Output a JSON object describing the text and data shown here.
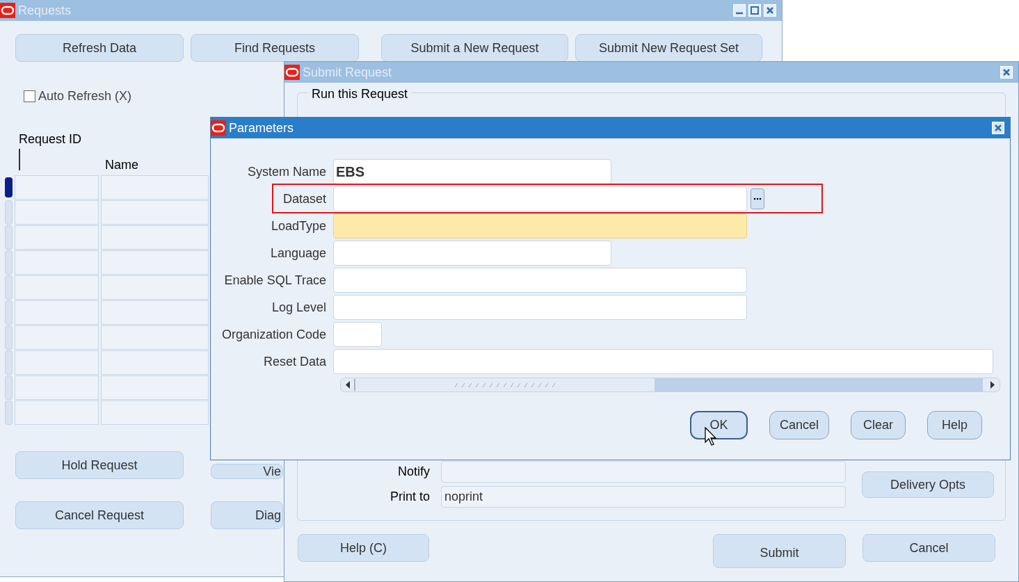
{
  "requests_window": {
    "title": "Requests",
    "active": false,
    "buttons": [
      "Refresh Data",
      "Find Requests",
      "Submit a New Request",
      "Submit New Request Set"
    ],
    "auto_refresh": {
      "label": "Auto Refresh (X)",
      "checked": false
    },
    "columns": [
      "Request ID",
      "Name"
    ],
    "rows": [
      {
        "selected": true
      },
      {
        "selected": false
      },
      {
        "selected": false
      },
      {
        "selected": false
      },
      {
        "selected": false
      },
      {
        "selected": false
      },
      {
        "selected": false
      },
      {
        "selected": false
      },
      {
        "selected": false
      },
      {
        "selected": false
      }
    ],
    "bottom_buttons": [
      "Hold Request",
      "Vie",
      "Cancel Request",
      "Diag"
    ]
  },
  "submit_window": {
    "title": "Submit Request",
    "active": false,
    "group_title": "Run this Request",
    "fields": [
      {
        "label": "Notify"
      },
      {
        "label": "Print to",
        "value": "noprint"
      }
    ],
    "delivery_button": "Delivery Opts",
    "buttons": [
      "Help (C)",
      "Submit",
      "Cancel"
    ]
  },
  "parameters_window": {
    "title": "Parameters",
    "active": true,
    "fields": [
      {
        "label": "System Name",
        "value": "EBS",
        "required": false,
        "highlighted": false,
        "lov": false
      },
      {
        "label": "Dataset",
        "required": false,
        "highlighted": true,
        "lov": true
      },
      {
        "label": "LoadType",
        "required": true,
        "highlighted": false,
        "lov": false
      },
      {
        "label": "Language",
        "required": false,
        "highlighted": false,
        "lov": false
      },
      {
        "label": "Enable SQL Trace",
        "required": false,
        "highlighted": false,
        "lov": false
      },
      {
        "label": "Log Level",
        "required": false,
        "highlighted": false,
        "lov": false
      },
      {
        "label": "Organization Code",
        "required": false,
        "highlighted": false,
        "lov": false
      },
      {
        "label": "Reset Data",
        "required": false,
        "highlighted": false,
        "lov": false
      }
    ],
    "buttons": [
      {
        "label": "OK",
        "focused": true
      },
      {
        "label": "Cancel",
        "focused": false
      },
      {
        "label": "Clear",
        "focused": false
      },
      {
        "label": "Help",
        "focused": false
      }
    ]
  }
}
